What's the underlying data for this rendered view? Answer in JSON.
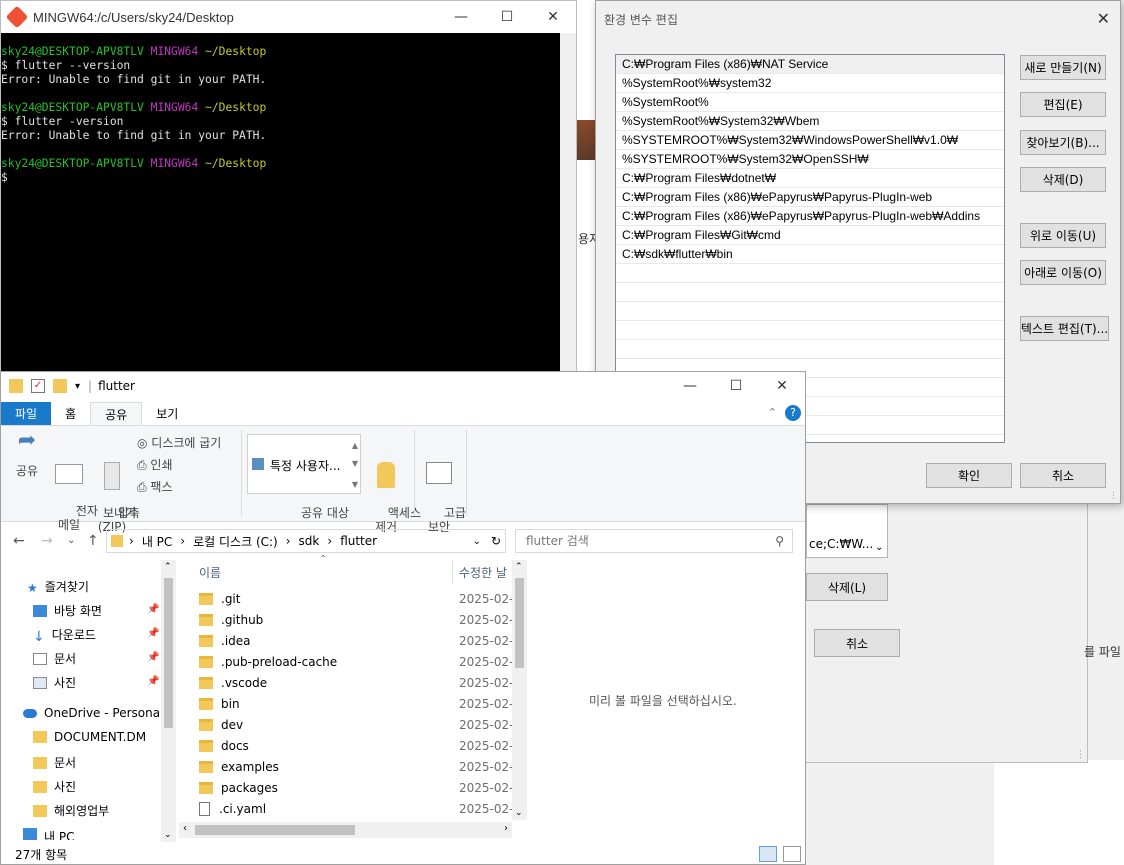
{
  "terminal": {
    "title": "MINGW64:/c/Users/sky24/Desktop",
    "lines": [
      {
        "user": "sky24@DESKTOP-APV8TLV",
        "host": "MINGW64",
        "path": "~/Desktop"
      },
      {
        "text": "$ flutter --version"
      },
      {
        "text": "Error: Unable to find git in your PATH."
      },
      {
        "text": ""
      },
      {
        "user": "sky24@DESKTOP-APV8TLV",
        "host": "MINGW64",
        "path": "~/Desktop"
      },
      {
        "text": "$ flutter -version"
      },
      {
        "text": "Error: Unable to find git in your PATH."
      },
      {
        "text": ""
      },
      {
        "user": "sky24@DESKTOP-APV8TLV",
        "host": "MINGW64",
        "path": "~/Desktop"
      },
      {
        "text": "$ "
      }
    ]
  },
  "env_dialog": {
    "title": "환경 변수 편집",
    "entries": [
      "C:₩Program Files (x86)₩NAT Service",
      "%SystemRoot%₩system32",
      "%SystemRoot%",
      "%SystemRoot%₩System32₩Wbem",
      "%SYSTEMROOT%₩System32₩WindowsPowerShell₩v1.0₩",
      "%SYSTEMROOT%₩System32₩OpenSSH₩",
      "C:₩Program Files₩dotnet₩",
      "C:₩Program Files (x86)₩ePapyrus₩Papyrus-PlugIn-web",
      "C:₩Program Files (x86)₩ePapyrus₩Papyrus-PlugIn-web₩Addins",
      "C:₩Program Files₩Git₩cmd",
      "C:₩sdk₩flutter₩bin"
    ],
    "buttons": {
      "new": "새로 만들기(N)",
      "edit": "편집(E)",
      "browse": "찾아보기(B)...",
      "delete": "삭제(D)",
      "move_up": "위로 이동(U)",
      "move_down": "아래로 이동(O)",
      "edit_text": "텍스트 편집(T)...",
      "ok": "확인",
      "cancel": "취소"
    }
  },
  "behind_dialog": {
    "value_snippet": "ce;C:₩W...",
    "delete": "삭제(L)",
    "cancel": "취소",
    "side_text": "를 파일",
    "left_fragment": "용지"
  },
  "explorer": {
    "title": "flutter",
    "tabs": [
      "파일",
      "홈",
      "공유",
      "보기"
    ],
    "ribbon": {
      "share": "공유",
      "email": "전자\n메일",
      "zip": "압축\n(ZIP)",
      "burn": "디스크에 굽기",
      "print": "인쇄",
      "fax": "팩스",
      "send_group": "보내기",
      "share_with": "특정 사용자...",
      "share_group": "공유 대상",
      "remove_access": "액세스\n제거",
      "advanced": "고급\n보안"
    },
    "breadcrumb": [
      "내 PC",
      "로컬 디스크 (C:)",
      "sdk",
      "flutter"
    ],
    "search_placeholder": "flutter 검색",
    "nav": {
      "quick_access": "즐겨찾기",
      "desktop": "바탕 화면",
      "downloads": "다운로드",
      "documents": "문서",
      "pictures": "사진",
      "onedrive": "OneDrive - Personal",
      "od_document": "DOCUMENT.DM",
      "od_docs": "문서",
      "od_pics": "사진",
      "od_overseas": "해외영업부",
      "this_pc": "내 PC"
    },
    "columns": {
      "name": "이름",
      "modified": "수정한 날"
    },
    "files": [
      {
        "name": ".git",
        "type": "folder",
        "date": "2025-02-"
      },
      {
        "name": ".github",
        "type": "folder",
        "date": "2025-02-"
      },
      {
        "name": ".idea",
        "type": "folder",
        "date": "2025-02-"
      },
      {
        "name": ".pub-preload-cache",
        "type": "folder",
        "date": "2025-02-"
      },
      {
        "name": ".vscode",
        "type": "folder",
        "date": "2025-02-"
      },
      {
        "name": "bin",
        "type": "folder",
        "date": "2025-02-"
      },
      {
        "name": "dev",
        "type": "folder",
        "date": "2025-02-"
      },
      {
        "name": "docs",
        "type": "folder",
        "date": "2025-02-"
      },
      {
        "name": "examples",
        "type": "folder",
        "date": "2025-02-"
      },
      {
        "name": "packages",
        "type": "folder",
        "date": "2025-02-"
      },
      {
        "name": ".ci.yaml",
        "type": "file",
        "date": "2025-02-"
      }
    ],
    "preview_message": "미리 볼 파일을 선택하십시오.",
    "status": "27개 항목"
  }
}
